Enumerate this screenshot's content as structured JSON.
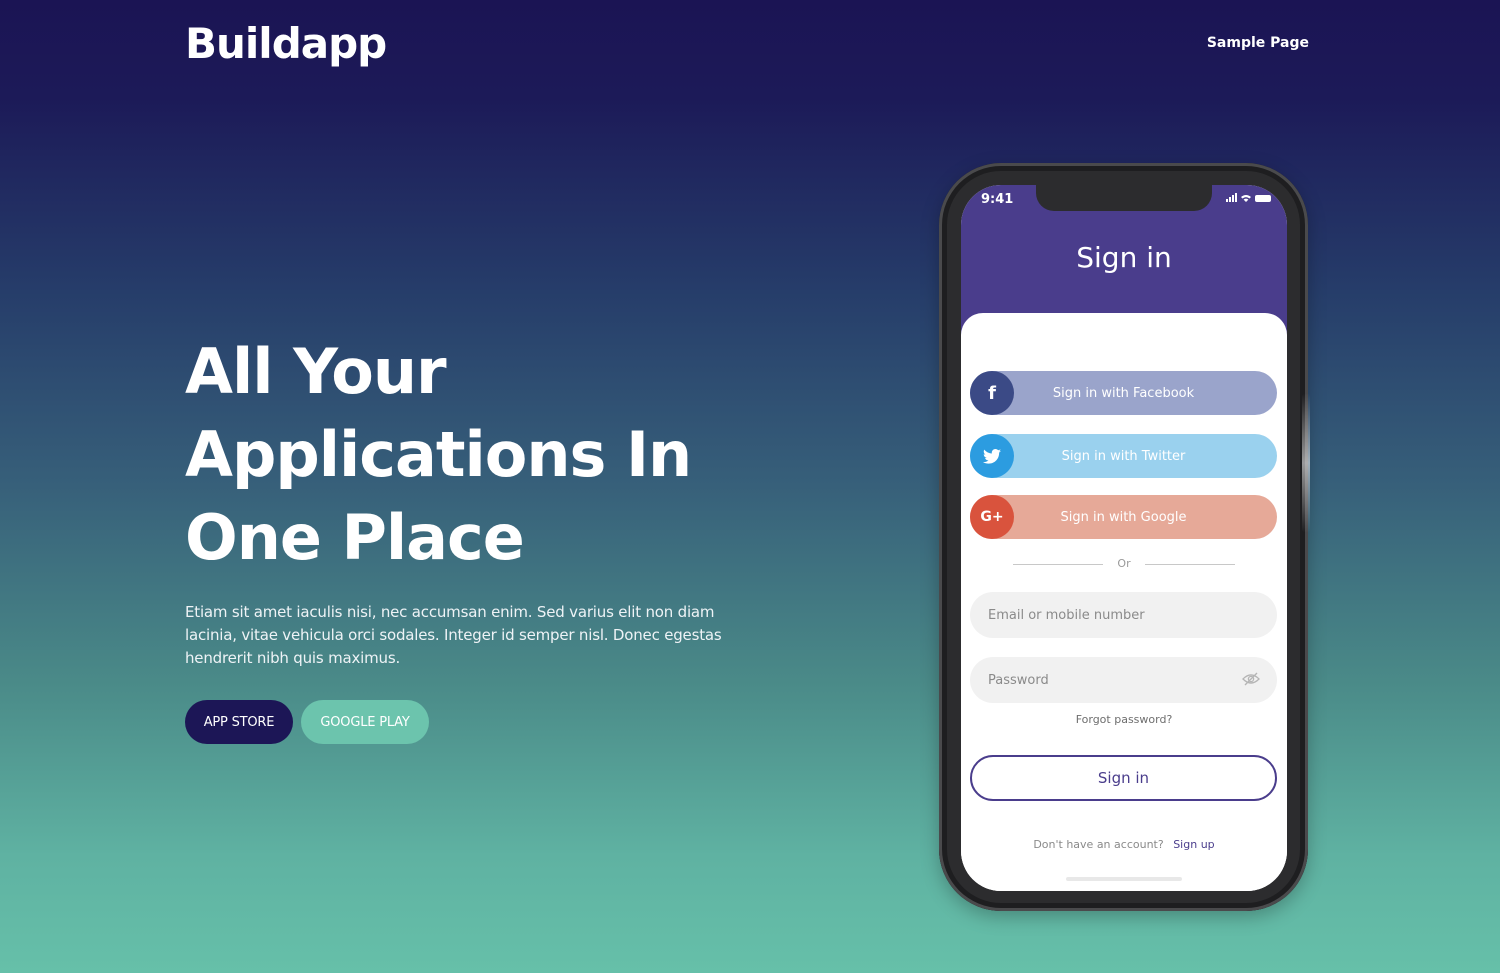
{
  "header": {
    "logo": "Buildapp",
    "nav_link": "Sample Page"
  },
  "hero": {
    "title_lines": [
      "All Your",
      "Applications In",
      "One Place"
    ],
    "text": "Etiam sit amet iaculis nisi, nec accumsan enim. Sed varius elit non diam lacinia, vitae vehicula orci sodales. Integer id semper nisl. Donec egestas hendrerit nibh quis maximus.",
    "app_store_label": "APP STORE",
    "google_play_label": "GOOGLE PLAY"
  },
  "phone": {
    "status_time": "9:41",
    "title": "Sign in",
    "social": [
      {
        "label": "Sign in with Facebook",
        "icon": "facebook-icon",
        "glyph": "f"
      },
      {
        "label": "Sign in with Twitter",
        "icon": "twitter-icon",
        "glyph": ""
      },
      {
        "label": "Sign in with Google",
        "icon": "google-plus-icon",
        "glyph": "G+"
      }
    ],
    "or_text": "Or",
    "email_placeholder": "Email or mobile number",
    "password_placeholder": "Password",
    "forgot_password": "Forgot password?",
    "signin_button": "Sign in",
    "signup_question": "Don't have an account?",
    "signup_link": "Sign up"
  },
  "colors": {
    "brand_dark": "#1c1656",
    "accent_teal": "#6cc4ad",
    "phone_header": "#4a3d8c",
    "facebook": "#3b4a86",
    "twitter": "#2c9ce0",
    "google": "#d9533d"
  }
}
